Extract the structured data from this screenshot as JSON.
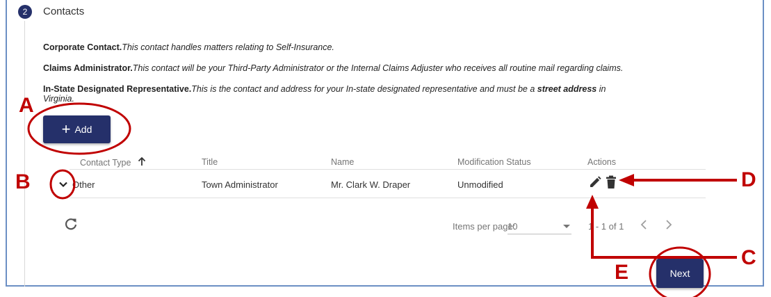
{
  "step": {
    "number": "2",
    "title": "Contacts"
  },
  "descriptions": [
    {
      "bold": "Corporate Contact.",
      "italic": "This contact handles matters relating to Self-Insurance."
    },
    {
      "bold": "Claims Administrator.",
      "italic": "This contact will be your Third-Party Administrator or the Internal Claims Adjuster who receives all routine mail regarding claims."
    },
    {
      "bold": "In-State Designated Representative.",
      "italic_line1": "This is the contact and address for your In-state designated representative and must be a ",
      "bold_italic": "street address",
      "italic_line1_end": " in",
      "italic_line2": "Virginia."
    }
  ],
  "add_button": {
    "label": "Add"
  },
  "table": {
    "headers": {
      "contact_type": "Contact Type",
      "title": "Title",
      "name": "Name",
      "status": "Modification Status",
      "actions": "Actions"
    },
    "rows": [
      {
        "contact_type": "Other",
        "title": "Town Administrator",
        "name": "Mr. Clark W. Draper",
        "status": "Unmodified"
      }
    ]
  },
  "paginator": {
    "label": "Items per page:",
    "page_size": "10",
    "range": "1 - 1 of 1"
  },
  "next_button": {
    "label": "Next"
  },
  "annotations": {
    "a": "A",
    "b": "B",
    "c": "C",
    "d": "D",
    "e": "E"
  },
  "colors": {
    "primary": "#25306a",
    "annotation": "#c00000",
    "frame": "#6b8fc4"
  }
}
